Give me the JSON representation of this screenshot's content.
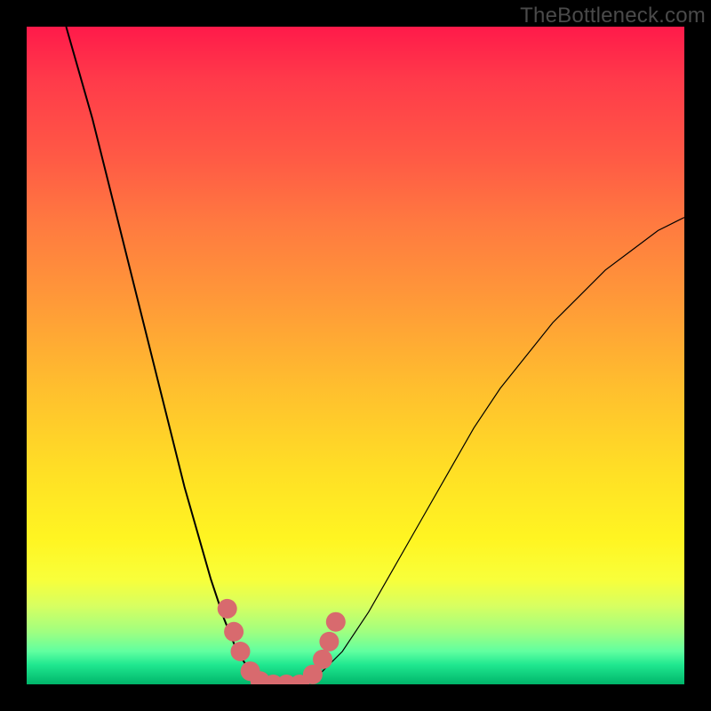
{
  "watermark": "TheBottleneck.com",
  "chart_data": {
    "type": "line",
    "title": "",
    "xlabel": "",
    "ylabel": "",
    "xlim": [
      0,
      100
    ],
    "ylim": [
      0,
      100
    ],
    "note": "Axes unlabeled; values estimated from pixel positions on a 0–100 normalized scale. y=100 at top. Curve shows steep descent to a minimum near x≈34–44 (y≈0) then rises again.",
    "series": [
      {
        "name": "bottleneck-curve-left",
        "stroke_width": 2.0,
        "x": [
          6,
          8,
          10,
          12,
          14,
          16,
          18,
          20,
          22,
          24,
          26,
          28,
          30,
          32,
          34,
          36
        ],
        "y": [
          100,
          93,
          86,
          78,
          70,
          62,
          54,
          46,
          38,
          30,
          23,
          16,
          10,
          5,
          2,
          0
        ]
      },
      {
        "name": "bottleneck-curve-right",
        "stroke_width": 1.2,
        "x": [
          40,
          44,
          48,
          52,
          56,
          60,
          64,
          68,
          72,
          76,
          80,
          84,
          88,
          92,
          96,
          100
        ],
        "y": [
          0,
          1,
          5,
          11,
          18,
          25,
          32,
          39,
          45,
          50,
          55,
          59,
          63,
          66,
          69,
          71
        ]
      }
    ],
    "markers": {
      "name": "highlight-dots",
      "color": "#d86a6e",
      "radius_px": 11,
      "points": [
        {
          "x": 30.5,
          "y": 11.5
        },
        {
          "x": 31.5,
          "y": 8.0
        },
        {
          "x": 32.5,
          "y": 5.0
        },
        {
          "x": 34.0,
          "y": 2.0
        },
        {
          "x": 35.5,
          "y": 0.5
        },
        {
          "x": 37.5,
          "y": 0.0
        },
        {
          "x": 39.5,
          "y": 0.0
        },
        {
          "x": 41.5,
          "y": 0.0
        },
        {
          "x": 43.5,
          "y": 1.5
        },
        {
          "x": 45.0,
          "y": 3.8
        },
        {
          "x": 46.0,
          "y": 6.5
        },
        {
          "x": 47.0,
          "y": 9.5
        }
      ]
    }
  }
}
